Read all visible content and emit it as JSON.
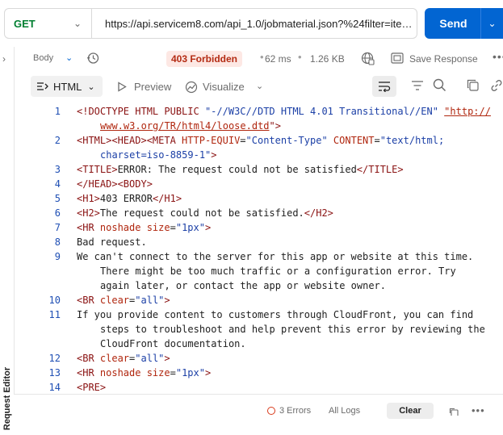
{
  "request": {
    "method": "GET",
    "url": "https://api.servicem8.com/api_1.0/jobmaterial.json?%24filter=item_uuid...",
    "send_label": "Send"
  },
  "response": {
    "body_tab": "Body",
    "status": "403 Forbidden",
    "time": "62 ms",
    "size": "1.26 KB",
    "save_label": "Save Response"
  },
  "toolbar": {
    "format": "HTML",
    "preview": "Preview",
    "visualize": "Visualize"
  },
  "sidebar_label": "Request Editor",
  "code_lines": [
    {
      "n": "1",
      "parts": [
        {
          "c": "tg",
          "t": "<!DOCTYPE HTML PUBLIC "
        },
        {
          "c": "st",
          "t": "\"-//W3C//DTD HTML 4.01 Transitional//EN\""
        },
        {
          "c": "",
          "t": " "
        },
        {
          "c": "lk",
          "t": "\"http://"
        }
      ]
    },
    {
      "n": "",
      "ind": true,
      "parts": [
        {
          "c": "lk",
          "t": "www.w3.org/TR/html4/loose.dtd"
        },
        {
          "c": "tg",
          "t": "\">"
        }
      ]
    },
    {
      "n": "2",
      "parts": [
        {
          "c": "tg",
          "t": "<HTML><HEAD><META "
        },
        {
          "c": "at",
          "t": "HTTP-EQUIV"
        },
        {
          "c": "",
          "t": "="
        },
        {
          "c": "st",
          "t": "\"Content-Type\""
        },
        {
          "c": "",
          "t": " "
        },
        {
          "c": "at",
          "t": "CONTENT"
        },
        {
          "c": "",
          "t": "="
        },
        {
          "c": "st",
          "t": "\"text/html;"
        }
      ]
    },
    {
      "n": "",
      "ind": true,
      "parts": [
        {
          "c": "st",
          "t": "charset=iso-8859-1\""
        },
        {
          "c": "tg",
          "t": ">"
        }
      ]
    },
    {
      "n": "3",
      "parts": [
        {
          "c": "tg",
          "t": "<TITLE>"
        },
        {
          "c": "",
          "t": "ERROR: The request could not be satisfied"
        },
        {
          "c": "tg",
          "t": "</TITLE>"
        }
      ]
    },
    {
      "n": "4",
      "parts": [
        {
          "c": "tg",
          "t": "</HEAD><BODY>"
        }
      ]
    },
    {
      "n": "5",
      "parts": [
        {
          "c": "tg",
          "t": "<H1>"
        },
        {
          "c": "",
          "t": "403 ERROR"
        },
        {
          "c": "tg",
          "t": "</H1>"
        }
      ]
    },
    {
      "n": "6",
      "parts": [
        {
          "c": "tg",
          "t": "<H2>"
        },
        {
          "c": "",
          "t": "The request could not be satisfied."
        },
        {
          "c": "tg",
          "t": "</H2>"
        }
      ]
    },
    {
      "n": "7",
      "parts": [
        {
          "c": "tg",
          "t": "<HR "
        },
        {
          "c": "at",
          "t": "noshade size"
        },
        {
          "c": "",
          "t": "="
        },
        {
          "c": "st",
          "t": "\"1px\""
        },
        {
          "c": "tg",
          "t": ">"
        }
      ]
    },
    {
      "n": "8",
      "parts": [
        {
          "c": "",
          "t": "Bad request."
        }
      ]
    },
    {
      "n": "9",
      "parts": [
        {
          "c": "",
          "t": "We can't connect to the server for this app or website at this time."
        }
      ]
    },
    {
      "n": "",
      "ind": true,
      "parts": [
        {
          "c": "",
          "t": "There might be too much traffic or a configuration error. Try"
        }
      ]
    },
    {
      "n": "",
      "ind": true,
      "parts": [
        {
          "c": "",
          "t": "again later, or contact the app or website owner."
        }
      ]
    },
    {
      "n": "10",
      "parts": [
        {
          "c": "tg",
          "t": "<BR "
        },
        {
          "c": "at",
          "t": "clear"
        },
        {
          "c": "",
          "t": "="
        },
        {
          "c": "st",
          "t": "\"all\""
        },
        {
          "c": "tg",
          "t": ">"
        }
      ]
    },
    {
      "n": "11",
      "parts": [
        {
          "c": "",
          "t": "If you provide content to customers through CloudFront, you can find"
        }
      ]
    },
    {
      "n": "",
      "ind": true,
      "parts": [
        {
          "c": "",
          "t": "steps to troubleshoot and help prevent this error by reviewing the"
        }
      ]
    },
    {
      "n": "",
      "ind": true,
      "parts": [
        {
          "c": "",
          "t": "CloudFront documentation."
        }
      ]
    },
    {
      "n": "12",
      "parts": [
        {
          "c": "tg",
          "t": "<BR "
        },
        {
          "c": "at",
          "t": "clear"
        },
        {
          "c": "",
          "t": "="
        },
        {
          "c": "st",
          "t": "\"all\""
        },
        {
          "c": "tg",
          "t": ">"
        }
      ]
    },
    {
      "n": "13",
      "parts": [
        {
          "c": "tg",
          "t": "<HR "
        },
        {
          "c": "at",
          "t": "noshade size"
        },
        {
          "c": "",
          "t": "="
        },
        {
          "c": "st",
          "t": "\"1px\""
        },
        {
          "c": "tg",
          "t": ">"
        }
      ]
    },
    {
      "n": "14",
      "parts": [
        {
          "c": "tg",
          "t": "<PRE>"
        }
      ]
    }
  ],
  "footer": {
    "errors": "3 Errors",
    "all_logs": "All Logs",
    "clear": "Clear"
  },
  "colors": {
    "send": "#0265d2",
    "status_bg": "#fde8e4",
    "status_fg": "#b42b13",
    "method": "#007f31"
  },
  "icons": [
    "history-icon",
    "globe-icon",
    "save-icon",
    "play-icon",
    "visualize-icon",
    "wrap-icon",
    "filter-icon",
    "search-icon",
    "copy-icon",
    "link-icon"
  ]
}
